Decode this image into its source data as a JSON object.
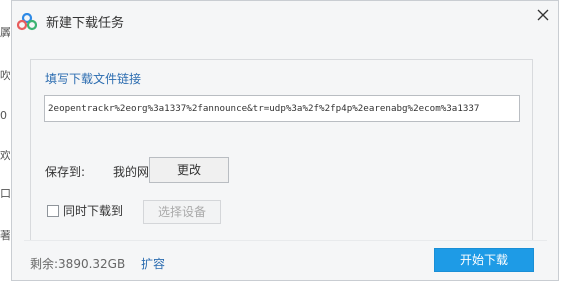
{
  "background_fragments": [
    "羼",
    "吹",
    "0",
    "欢",
    "口",
    "著"
  ],
  "dialog": {
    "title": "新建下载任务",
    "app_icon": "baidu-netdisk-cloud-icon",
    "close_icon": "close-icon"
  },
  "link_section": {
    "label": "填写下载文件链接",
    "url_value": "2eopentrackr%2eorg%3a1337%2fannounce&tr=udp%3a%2f%2fp4p%2earenabg%2ecom%3a1337"
  },
  "save_section": {
    "label": "保存到:",
    "location": "我的网盘",
    "change_button": "更改"
  },
  "device_section": {
    "checkbox_label": "同时下载到",
    "checked": false,
    "select_device_button": "选择设备"
  },
  "footer": {
    "remaining_label": "剩余:",
    "remaining_value": "3890.32GB",
    "expand_link": "扩容",
    "start_button": "开始下载"
  },
  "colors": {
    "accent": "#1e9be6",
    "link": "#2b6cb0",
    "dialog_bg": "#f5f6f7"
  }
}
